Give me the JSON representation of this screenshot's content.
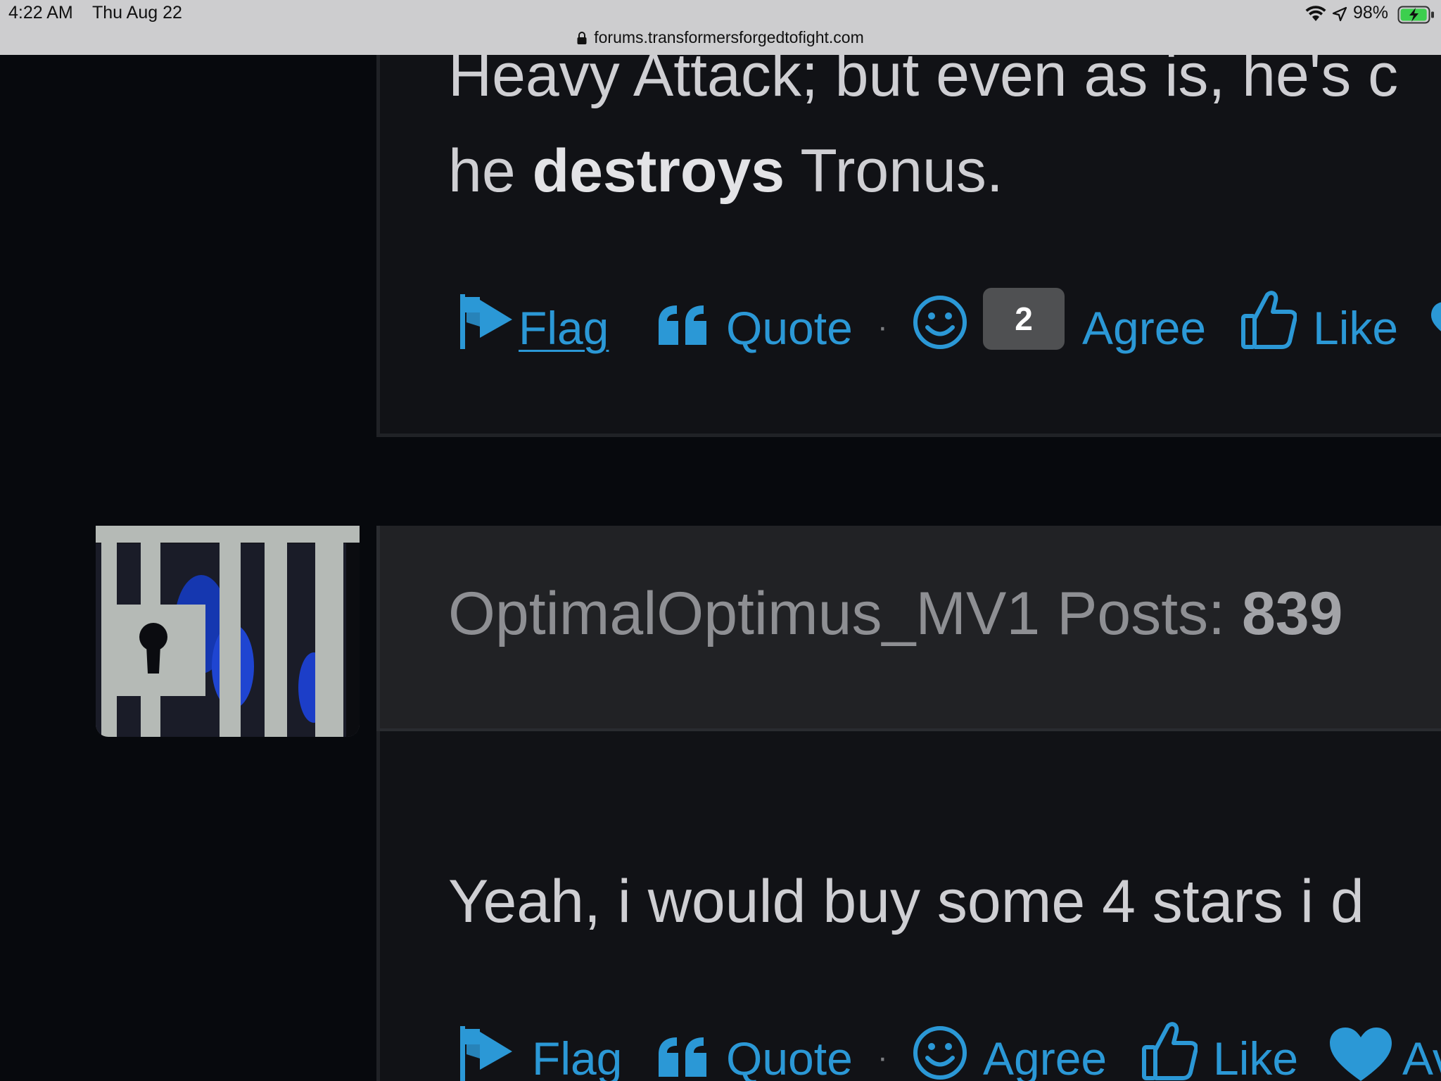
{
  "status_bar": {
    "time": "4:22 AM",
    "date": "Thu Aug 22",
    "battery_percent": "98%",
    "battery_level": 0.98,
    "icons": [
      "wifi-icon",
      "location-icon",
      "battery-charging-icon"
    ]
  },
  "browser": {
    "url": "forums.transformersforgedtofight.com",
    "lock_icon": "lock-icon"
  },
  "post1": {
    "line1": "Heavy Attack; but even as is, he's c",
    "line2_before": "he ",
    "line2_bold": "destroys",
    "line2_after": " Tronus.",
    "actions": {
      "flag": "Flag",
      "quote": "Quote",
      "separator": "·",
      "agree_count": "2",
      "agree": "Agree",
      "like": "Like"
    }
  },
  "post2": {
    "author": "OptimalOptimus_MV1",
    "posts_label": "Posts:",
    "posts_count": "839",
    "body": "Yeah, i would buy some 4 stars i d",
    "actions": {
      "flag": "Flag",
      "quote": "Quote",
      "separator": "·",
      "agree": "Agree",
      "like": "Like",
      "awesome": "Av"
    }
  },
  "colors": {
    "page_bg": "#07090d",
    "post_bg": "#111216",
    "header_bg": "#212225",
    "link": "#2b98d6",
    "badge_bg": "#4f5052",
    "status_bar_bg": "#cdcdcf"
  }
}
